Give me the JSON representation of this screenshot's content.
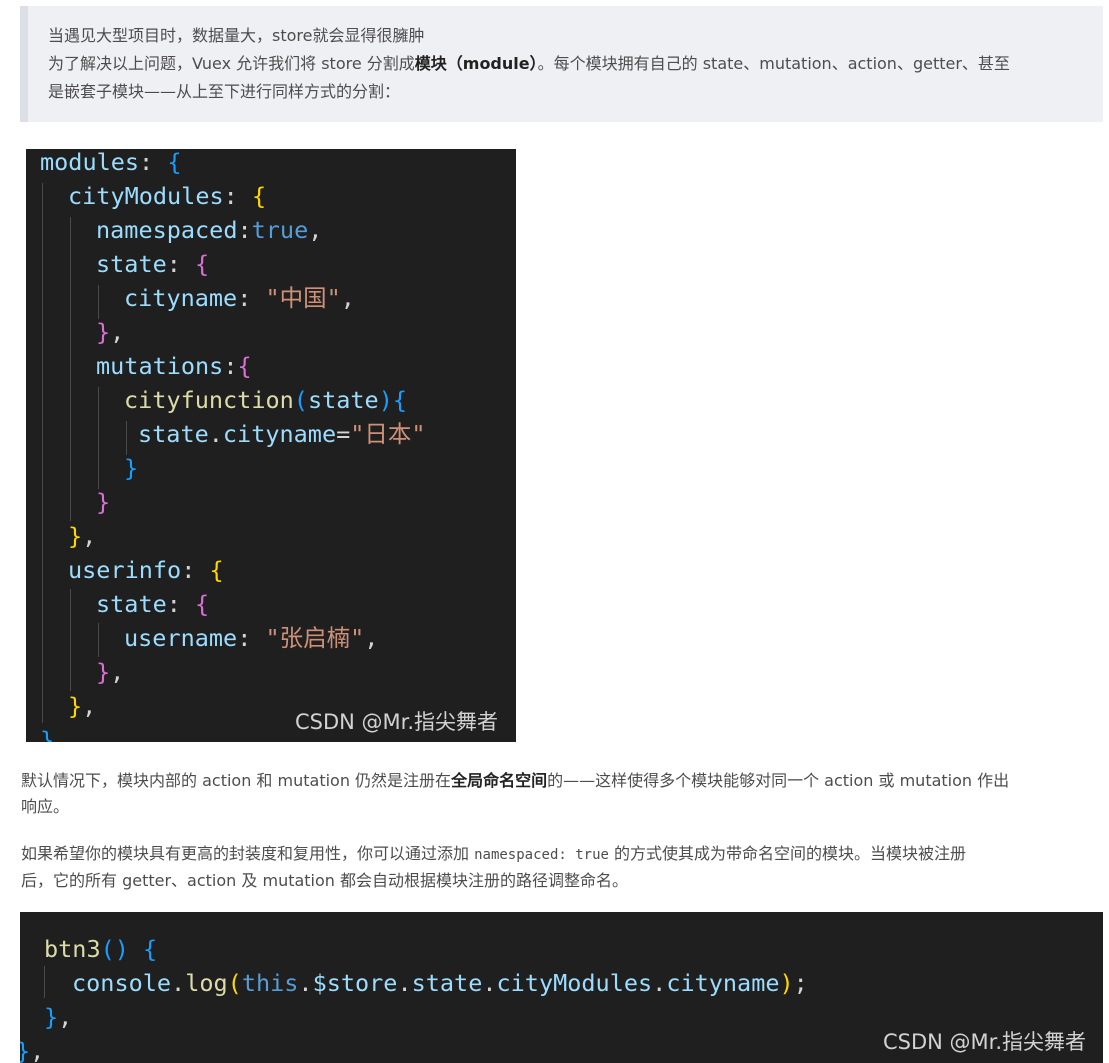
{
  "quote": {
    "line1": "当遇见大型项目时，数据量大，store就会显得很臃肿",
    "line2_a": "为了解决以上问题，Vuex 允许我们将 store 分割成",
    "line2_bold": "模块（module）",
    "line2_b": "。每个模块拥有自己的 state、mutation、action、getter、甚至",
    "line3": "是嵌套子模块——从上至下进行同样方式的分割："
  },
  "code1": {
    "watermark": "CSDN @Mr.指尖舞者",
    "modules_key": "modules",
    "city_key": "cityModules",
    "namespaced_key": "namespaced",
    "namespaced_val": "true",
    "state_key": "state",
    "cityname_key": "cityname",
    "cityname_val": "\"中国\"",
    "mutations_key": "mutations",
    "cityfunction_name": "cityfunction",
    "param": "state",
    "assign_obj": "state",
    "assign_prop": "cityname",
    "assign_val": "\"日本\"",
    "userinfo_key": "userinfo",
    "username_key": "username",
    "username_val": "\"张启楠\""
  },
  "para1": {
    "a": " 默认情况下，模块内部的 action 和 mutation 仍然是注册在",
    "bold": "全局命名空间",
    "b": "的——这样使得多个模块能够对同一个 action 或 mutation 作出",
    "c": "响应。"
  },
  "para2": {
    "a": "如果希望你的模块具有更高的封装度和复用性，你可以通过添加 ",
    "code": "namespaced: true",
    "b": " 的方式使其成为带命名空间的模块。当模块被注册",
    "c": "后，它的所有 getter、action 及 mutation 都会自动根据模块注册的路径调整命名。"
  },
  "code2": {
    "watermark": "CSDN @Mr.指尖舞者",
    "fn_name": "btn3",
    "console": "console",
    "log": "log",
    "this_kw": "this",
    "store": "$store",
    "state": "state",
    "module": "cityModules",
    "prop": "cityname"
  }
}
